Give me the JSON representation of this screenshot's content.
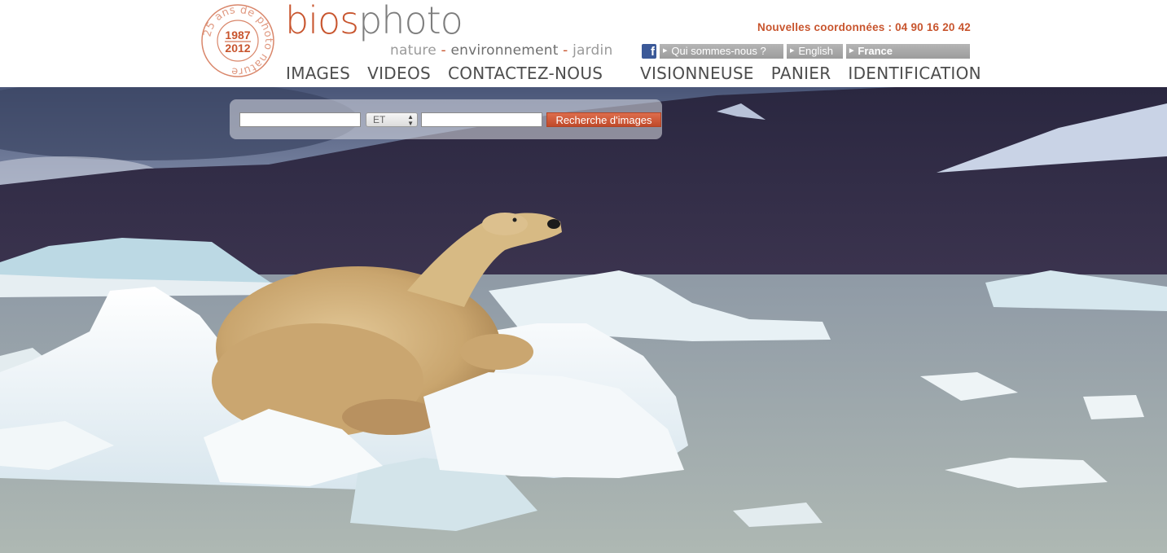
{
  "header": {
    "badge": {
      "years": "1987\n2012",
      "year_start": "1987",
      "year_end": "2012",
      "ring_text": "25 ans de photo nature"
    },
    "brand": {
      "part1": "bios",
      "part2": "photo"
    },
    "tagline": {
      "word1": "nature",
      "sep1": " - ",
      "word2": "environnement",
      "sep2": " - ",
      "word3": "jardin"
    },
    "phone": "Nouvelles coordonnées : 04 90 16 20 42",
    "toplinks": {
      "facebook_icon": "facebook-icon",
      "about": "Qui sommes-nous ?",
      "english": "English",
      "france": "France"
    },
    "nav_left": [
      "IMAGES",
      "VIDEOS",
      "CONTACTEZ-NOUS"
    ],
    "nav_right": [
      "VISIONNEUSE",
      "PANIER",
      "IDENTIFICATION"
    ]
  },
  "search": {
    "input1_value": "",
    "operator_selected": "ET",
    "input2_value": "",
    "button_label": "Recherche d'images"
  },
  "colors": {
    "brand_orange": "#c8552e",
    "brand_gray": "#7d7d7d",
    "nav_text": "#4d4d4d",
    "link_bar": "#a8a8a8"
  }
}
